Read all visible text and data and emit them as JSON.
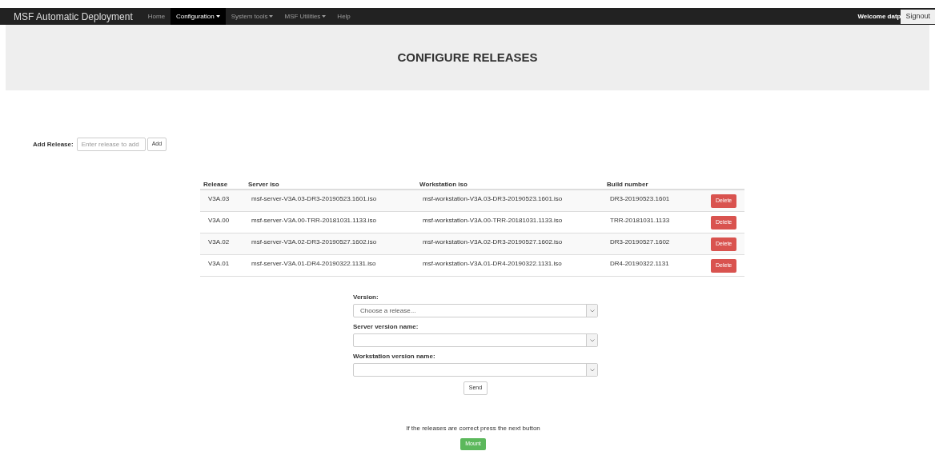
{
  "navbar": {
    "brand": "MSF Automatic Deployment",
    "items": [
      {
        "label": "Home",
        "dropdown": false,
        "selected": false
      },
      {
        "label": "Configuration",
        "dropdown": true,
        "selected": true
      },
      {
        "label": "System tools",
        "dropdown": true,
        "selected": false
      },
      {
        "label": "MSF Utilities",
        "dropdown": true,
        "selected": false
      },
      {
        "label": "Help",
        "dropdown": false,
        "selected": false
      }
    ],
    "welcome": "Welcome datp",
    "signout": "Signout"
  },
  "header": {
    "title": "CONFIGURE RELEASES"
  },
  "add_release": {
    "label": "Add Release:",
    "placeholder": "Enter release to add",
    "button": "Add"
  },
  "table": {
    "columns": [
      "Release",
      "Server iso",
      "Workstation iso",
      "Build number"
    ],
    "rows": [
      {
        "cells": [
          "V3A.03",
          "msf-server-V3A.03-DR3-20190523.1601.iso",
          "msf-workstation-V3A.03-DR3-20190523.1601.iso",
          "DR3-20190523.1601"
        ],
        "action": "Delete"
      },
      {
        "cells": [
          "V3A.00",
          "msf-server-V3A.00-TRR-20181031.1133.iso",
          "msf-workstation-V3A.00-TRR-20181031.1133.iso",
          "TRR-20181031.1133"
        ],
        "action": "Delete"
      },
      {
        "cells": [
          "V3A.02",
          "msf-server-V3A.02-DR3-20190527.1602.iso",
          "msf-workstation-V3A.02-DR3-20190527.1602.iso",
          "DR3-20190527.1602"
        ],
        "action": "Delete"
      },
      {
        "cells": [
          "V3A.01",
          "msf-server-V3A.01-DR4-20190322.1131.iso",
          "msf-workstation-V3A.01-DR4-20190322.1131.iso",
          "DR4-20190322.1131"
        ],
        "action": "Delete"
      }
    ]
  },
  "form": {
    "fields": [
      {
        "label": "Version:",
        "placeholder": "Choose a release..."
      },
      {
        "label": "Server version name:"
      },
      {
        "label": "Workstation version name:"
      }
    ],
    "button": "Send"
  },
  "footer": {
    "note": "If the releases are correct press the next button",
    "button": "Mount"
  }
}
